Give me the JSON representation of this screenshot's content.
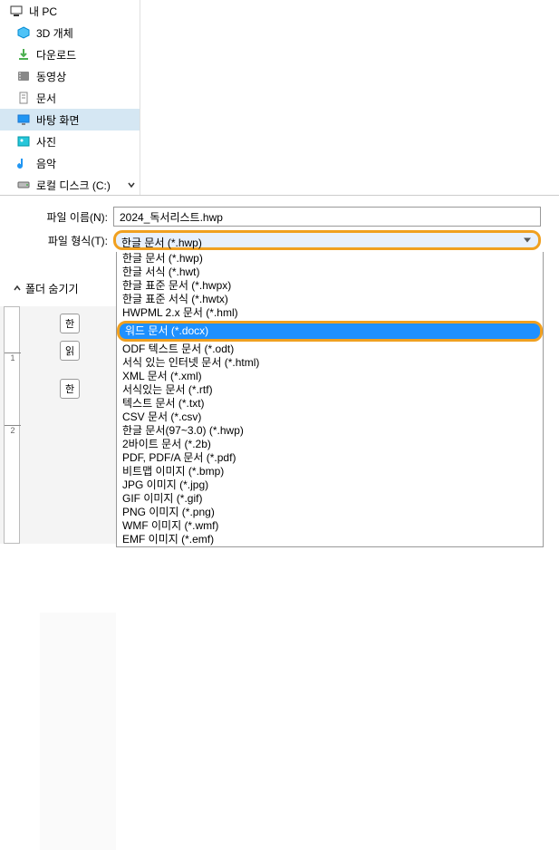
{
  "sidebar": {
    "root": "내 PC",
    "items": [
      {
        "label": "3D 개체",
        "icon": "cube"
      },
      {
        "label": "다운로드",
        "icon": "download"
      },
      {
        "label": "동영상",
        "icon": "video"
      },
      {
        "label": "문서",
        "icon": "documents"
      },
      {
        "label": "바탕 화면",
        "icon": "desktop"
      },
      {
        "label": "사진",
        "icon": "photos"
      },
      {
        "label": "음악",
        "icon": "music"
      },
      {
        "label": "로컬 디스크 (C:)",
        "icon": "disk"
      }
    ]
  },
  "fields": {
    "filename_label": "파일 이름(N):",
    "filename_value": "2024_독서리스트.hwp",
    "filetype_label": "파일 형식(T):",
    "filetype_value": "한글 문서 (*.hwp)"
  },
  "dropdown": [
    "한글 문서 (*.hwp)",
    "한글 서식 (*.hwt)",
    "한글 표준 문서 (*.hwpx)",
    "한글 표준 서식 (*.hwtx)",
    "HWPML 2.x 문서 (*.hml)",
    "워드 문서 (*.docx)",
    "ODF 텍스트 문서 (*.odt)",
    "서식 있는 인터넷 문서 (*.html)",
    "XML 문서 (*.xml)",
    "서식있는 문서 (*.rtf)",
    "텍스트 문서 (*.txt)",
    "CSV 문서 (*.csv)",
    "한글 문서(97~3.0) (*.hwp)",
    "2바이트 문서 (*.2b)",
    "PDF, PDF/A 문서 (*.pdf)",
    "비트맵 이미지 (*.bmp)",
    "JPG 이미지 (*.jpg)",
    "GIF 이미지 (*.gif)",
    "PNG 이미지 (*.png)",
    "WMF 이미지 (*.wmf)",
    "EMF 이미지 (*.emf)"
  ],
  "hide_folders": "폴더 숨기기",
  "ruler_marks": [
    "1",
    "2"
  ],
  "doc_buttons": [
    "한",
    "읽",
    "한"
  ]
}
